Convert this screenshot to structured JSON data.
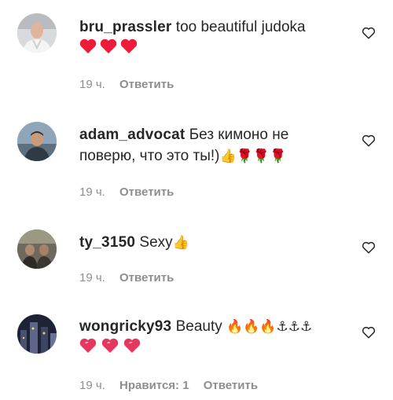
{
  "comments": [
    {
      "username": "bru_prassler",
      "text": " too beautiful judoka",
      "emojis2": "❤️❤️❤️",
      "time": "19 ч.",
      "reply": "Ответить"
    },
    {
      "username": "adam_advocat",
      "text": " Без кимоно не поверю, что это ты!)",
      "emojis": "👍🌹🌹🌹",
      "time": "19 ч.",
      "reply": "Ответить"
    },
    {
      "username": "ty_3150",
      "text": " Sexy",
      "emojis": "👍",
      "time": "19 ч.",
      "reply": "Ответить"
    },
    {
      "username": "wongricky93",
      "text": " Beauty ",
      "emojis": "🔥🔥🔥⚓⚓⚓",
      "emojis2": "💗💗💗",
      "time": "19 ч.",
      "likes": "Нравится: 1",
      "reply": "Ответить"
    }
  ],
  "colors": {
    "text": "#262626",
    "meta": "#8e8e8e",
    "heart_red": "#ed1c3a",
    "heart_pink": "#e8375e"
  }
}
